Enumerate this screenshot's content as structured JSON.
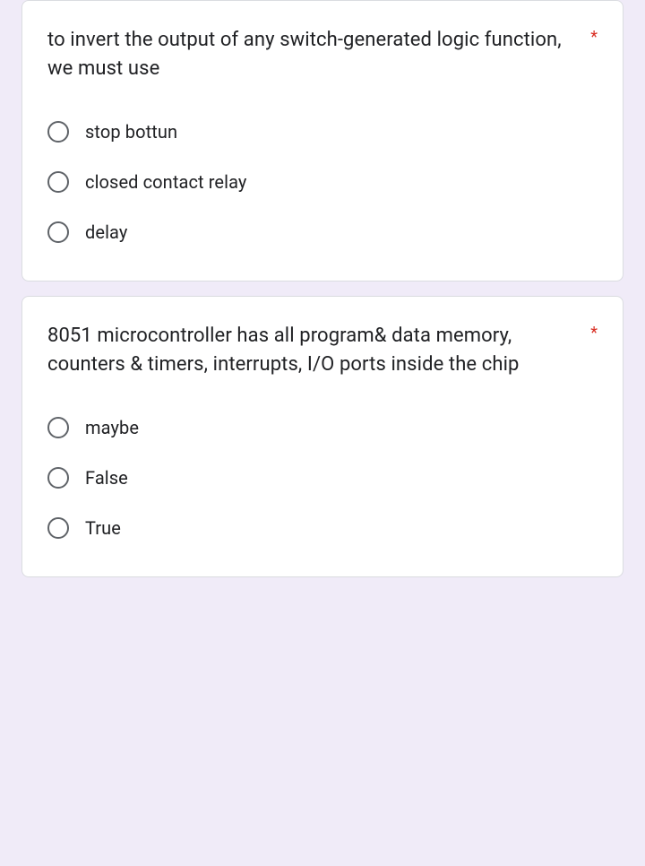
{
  "questions": [
    {
      "text": "to invert the output of any switch-generated logic function, we must use",
      "required": "*",
      "options": [
        {
          "label": "stop bottun"
        },
        {
          "label": "closed contact relay"
        },
        {
          "label": "delay"
        }
      ]
    },
    {
      "text": "8051 microcontroller has all program& data memory, counters & timers, interrupts, I/O ports inside the chip",
      "required": "*",
      "options": [
        {
          "label": "maybe"
        },
        {
          "label": "False"
        },
        {
          "label": "True"
        }
      ]
    }
  ]
}
